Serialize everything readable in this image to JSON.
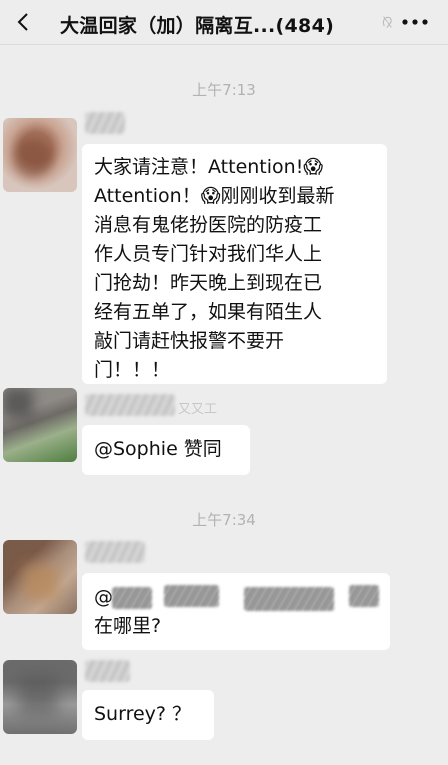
{
  "nav": {
    "title": "大温回家（加）隔离互...(484)",
    "back_icon": "chevron-left-icon",
    "mute_icon": "muted-ear-icon",
    "more_icon": "more-dots-icon"
  },
  "timestamps": [
    "上午7:13",
    "上午7:34"
  ],
  "messages": [
    {
      "text": "大家请注意！Attention!😱\nAttention！😱刚刚收到最新\n消息有鬼佬扮医院的防疫工\n作人员专门针对我们华人上\n门抢劫！昨天晚上到现在已\n经有五单了，如果有陌生人\n敲门请赶快报警不要开\n门！！！"
    },
    {
      "nickname_suffix": "又又工",
      "text": "@Sophie 赞同"
    },
    {
      "mention_prefix": "@",
      "text": "在哪里?"
    },
    {
      "text": "Surrey? ？"
    }
  ],
  "colors": {
    "background": "#ededed",
    "bubble": "#ffffff",
    "timestamp": "#b2b2b2"
  }
}
